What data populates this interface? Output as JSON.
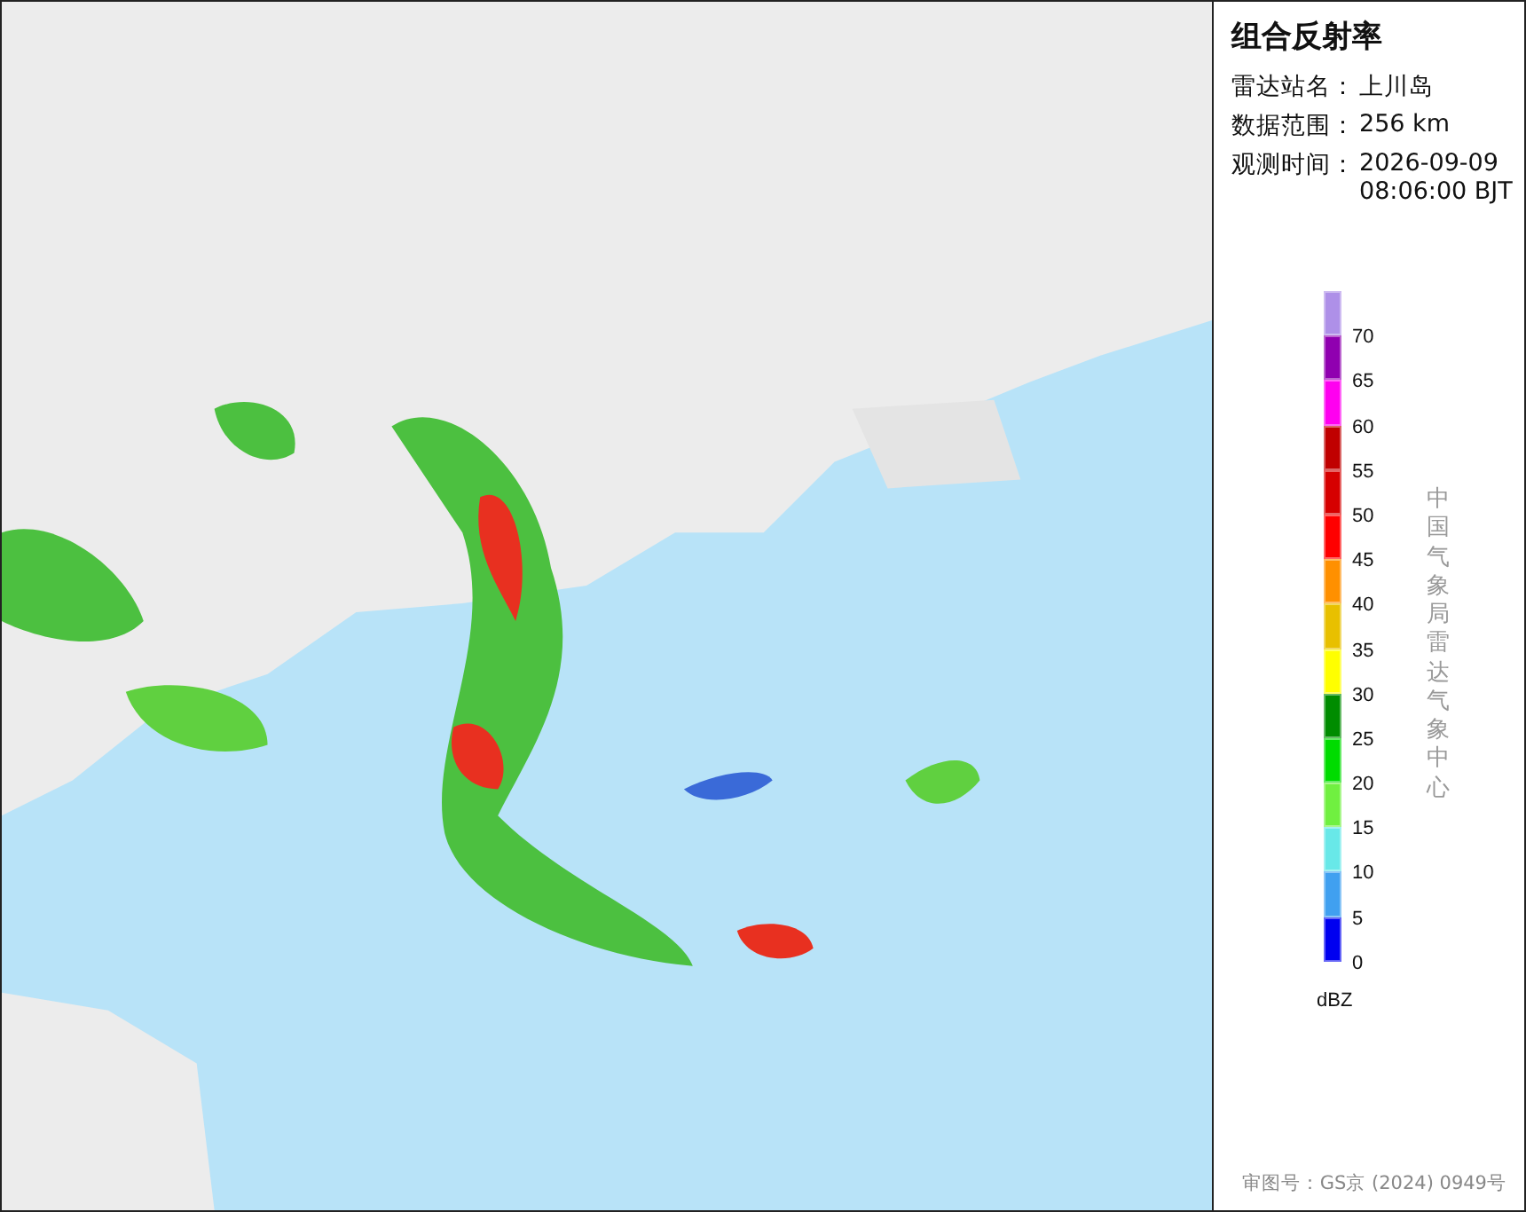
{
  "panel": {
    "title": "组合反射率",
    "info": [
      {
        "label": "雷达站名：",
        "value": "上川岛"
      },
      {
        "label": "数据范围：",
        "value": "256 km"
      },
      {
        "label": "观测时间：",
        "value": "2026-09-09",
        "value2": "08:06:00 BJT"
      }
    ],
    "legend": [
      {
        "label": "70",
        "color": "#ae90e8"
      },
      {
        "label": "65",
        "color": "#9000b0"
      },
      {
        "label": "60",
        "color": "#ff00f0"
      },
      {
        "label": "55",
        "color": "#c00000"
      },
      {
        "label": "50",
        "color": "#d60000"
      },
      {
        "label": "45",
        "color": "#ff0000"
      },
      {
        "label": "40",
        "color": "#ff9000"
      },
      {
        "label": "35",
        "color": "#e8c000"
      },
      {
        "label": "30",
        "color": "#ffff00"
      },
      {
        "label": "25",
        "color": "#008c00"
      },
      {
        "label": "20",
        "color": "#00dc00"
      },
      {
        "label": "15",
        "color": "#70f040"
      },
      {
        "label": "10",
        "color": "#68e8e8"
      },
      {
        "label": "5",
        "color": "#40a0f0"
      },
      {
        "label": "0",
        "color": "#0000f0"
      }
    ],
    "unit": "dBZ",
    "credit": "中国气象局雷达气象中心",
    "approval": "审图号：GS京 (2024) 0949号"
  }
}
